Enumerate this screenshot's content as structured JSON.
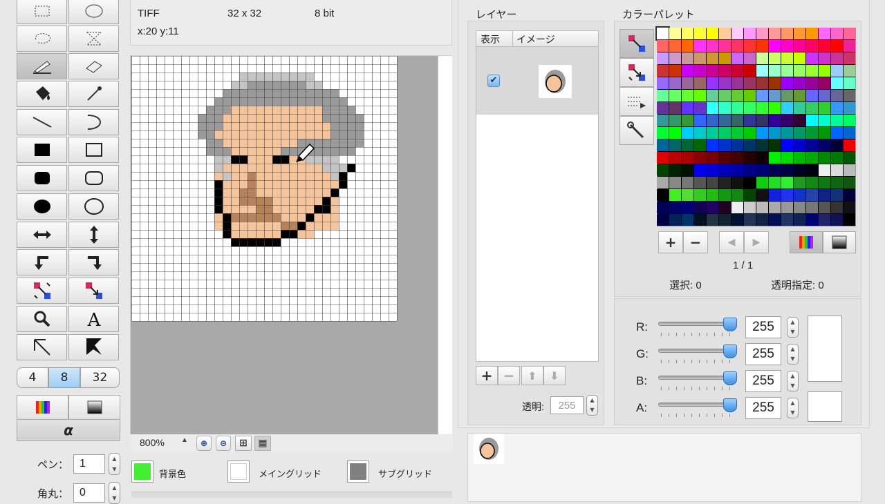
{
  "info": {
    "format": "TIFF",
    "size": "32 x 32",
    "depth": "8 bit",
    "coords": "x:20 y:11"
  },
  "pen": {
    "size_options": [
      "4",
      "8",
      "32"
    ],
    "selected_size": "8",
    "alpha_symbol": "α",
    "pen_label": "ペン：",
    "pen_value": "1",
    "round_label": "角丸：",
    "round_value": "0"
  },
  "zoom": {
    "value": "800%"
  },
  "bottom_bar": {
    "bg_label": "背景色",
    "main_grid_label": "メイングリッド",
    "sub_grid_label": "サブグリッド",
    "bg_color": "#44ee33",
    "sub_grid_color": "#808080"
  },
  "layers": {
    "title": "レイヤー",
    "col_show": "表示",
    "col_image": "イメージ",
    "opacity_label": "透明:",
    "opacity_value": "255"
  },
  "palette": {
    "title": "カラーパレット",
    "page": "1 / 1",
    "selected_label": "選択: 0",
    "transparent_label": "透明指定: 0"
  },
  "rgba": {
    "channels": [
      {
        "label": "R:",
        "value": "255"
      },
      {
        "label": "G:",
        "value": "255"
      },
      {
        "label": "B:",
        "value": "255"
      },
      {
        "label": "A:",
        "value": "255"
      }
    ]
  },
  "colors": {
    "skin": "#f5c49b",
    "hair": "#9a9a9a",
    "hair_light": "#c4c4c4",
    "outline": "#000000",
    "brown": "#b7825a",
    "accent_select": "#1e90ff"
  }
}
